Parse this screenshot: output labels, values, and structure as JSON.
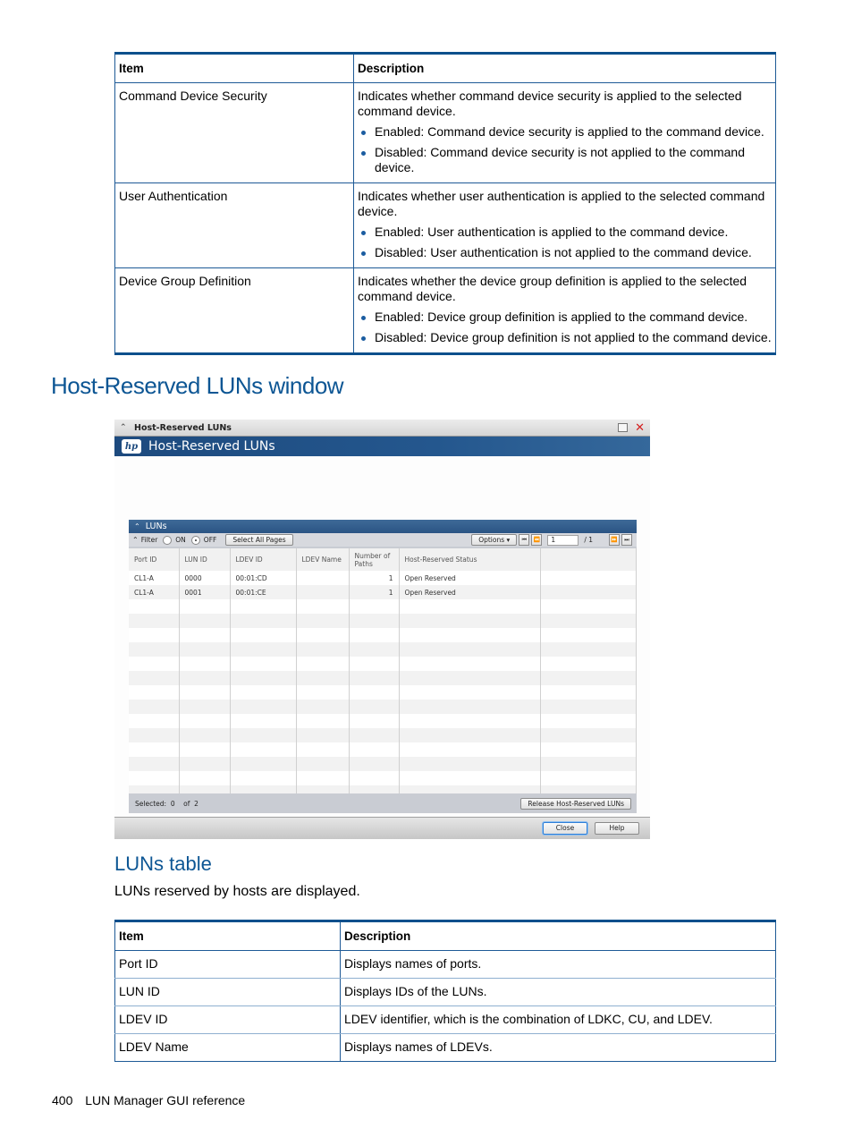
{
  "table1": {
    "headers": [
      "Item",
      "Description"
    ],
    "rows": [
      {
        "item": "Command Device Security",
        "desc": "Indicates whether command device security is applied to the selected command device.",
        "bullets": [
          "Enabled: Command device security is applied to the command device.",
          "Disabled: Command device security is not applied to the command device."
        ]
      },
      {
        "item": "User Authentication",
        "desc": "Indicates whether user authentication is applied to the selected command device.",
        "bullets": [
          "Enabled: User authentication is applied to the command device.",
          "Disabled: User authentication is not applied to the command device."
        ]
      },
      {
        "item": "Device Group Definition",
        "desc": "Indicates whether the device group definition is applied to the selected command device.",
        "bullets": [
          "Enabled: Device group definition is applied to the command device.",
          "Disabled: Device group definition is not applied to the command device."
        ]
      }
    ]
  },
  "section_title": "Host-Reserved LUNs window",
  "window": {
    "titlebar": "Host-Reserved LUNs",
    "banner": "Host-Reserved LUNs",
    "logo": "hp",
    "panel_title": "LUNs",
    "filter_label": "Filter",
    "radio_on": "ON",
    "radio_off": "OFF",
    "filter_state": "OFF",
    "select_all": "Select All Pages",
    "options": "Options",
    "page_current": "1",
    "page_total": "/ 1",
    "columns": [
      "Port ID",
      "LUN ID",
      "LDEV ID",
      "LDEV Name",
      "Number of Paths",
      "Host-Reserved Status",
      ""
    ],
    "rows": [
      [
        "CL1-A",
        "0000",
        "00:01:CD",
        "",
        "1",
        "Open Reserved",
        ""
      ],
      [
        "CL1-A",
        "0001",
        "00:01:CE",
        "",
        "1",
        "Open Reserved",
        ""
      ]
    ],
    "selected_label": "Selected:",
    "selected_count": "0",
    "of_label": "of",
    "total_count": "2",
    "release_button": "Release Host-Reserved LUNs",
    "close_button": "Close",
    "help_button": "Help"
  },
  "subsection_title": "LUNs table",
  "subsection_para": "LUNs reserved by hosts are displayed.",
  "table2": {
    "headers": [
      "Item",
      "Description"
    ],
    "rows": [
      {
        "item": "Port ID",
        "desc": "Displays names of ports."
      },
      {
        "item": "LUN ID",
        "desc": "Displays IDs of the LUNs."
      },
      {
        "item": "LDEV ID",
        "desc": "LDEV identifier, which is the combination of LDKC, CU, and LDEV."
      },
      {
        "item": "LDEV Name",
        "desc": "Displays names of LDEVs."
      }
    ]
  },
  "footer": {
    "page_number": "400",
    "text": "LUN Manager GUI reference"
  }
}
